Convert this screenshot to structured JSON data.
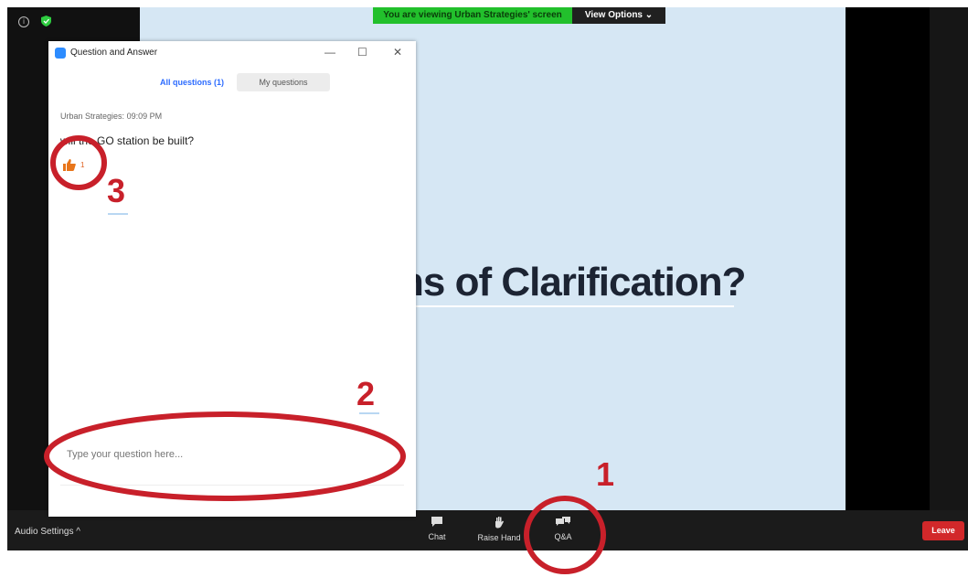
{
  "banner": {
    "sharing_text": "You are viewing Urban Strategies' screen",
    "view_options": "View Options ⌄"
  },
  "slide": {
    "title_fragment": "ns of Clarification?"
  },
  "qa_window": {
    "title": "Question and Answer",
    "controls": {
      "minimize": "—",
      "maximize": "☐",
      "close": "✕"
    },
    "tabs": {
      "all": "All questions (1)",
      "mine": "My questions"
    },
    "question": {
      "author": "Urban Strategies",
      "time": "09:09 PM",
      "text": "will the GO station be built?",
      "likes": "1"
    },
    "input_placeholder": "Type your question here..."
  },
  "toolbar": {
    "audio_settings": "Audio Settings ^",
    "chat": "Chat",
    "raise_hand": "Raise Hand",
    "qa": "Q&A",
    "leave": "Leave"
  },
  "annotations": {
    "one": "1",
    "two": "2",
    "three": "3"
  },
  "colors": {
    "annotation": "#c8202a",
    "banner": "#22c02c",
    "slide_bg": "#d6e7f4",
    "leave": "#d2282a",
    "accent": "#2d8cff"
  },
  "icons": {
    "info": "info-icon",
    "security": "shield-icon",
    "chat": "chat-icon",
    "raise_hand": "hand-icon",
    "qa": "qa-icon",
    "like": "thumbs-up-icon"
  }
}
